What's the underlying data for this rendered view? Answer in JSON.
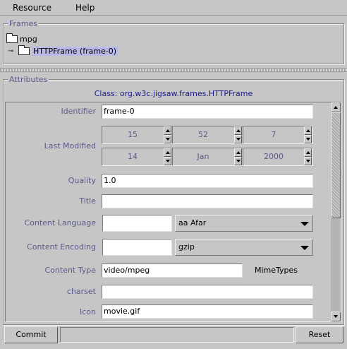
{
  "menubar": {
    "items": [
      "Resource",
      "Help"
    ]
  },
  "frames": {
    "title": "Frames",
    "items": [
      {
        "label": "mpg",
        "expanded": false,
        "selected": false
      },
      {
        "label": "HTTPFrame (frame-0)",
        "expander": "⊸",
        "selected": true
      }
    ]
  },
  "attributes": {
    "title": "Attributes",
    "class_label": "Class: org.w3c.jigsaw.frames.HTTPFrame",
    "identifier": {
      "label": "Identifier",
      "value": "frame-0"
    },
    "last_modified": {
      "label": "Last Modified",
      "row1": [
        "15",
        "52",
        "7"
      ],
      "row2": [
        "14",
        "Jan",
        "2000"
      ]
    },
    "quality": {
      "label": "Quality",
      "value": "1.0"
    },
    "title_field": {
      "label": "Title",
      "value": ""
    },
    "content_language": {
      "label": "Content Language",
      "value": "",
      "select": "aa  Afar"
    },
    "content_encoding": {
      "label": "Content Encoding",
      "value": "",
      "select": "gzip"
    },
    "content_type": {
      "label": "Content Type",
      "value": "video/mpeg",
      "extra": "MimeTypes"
    },
    "charset": {
      "label": "charset",
      "value": ""
    },
    "icon": {
      "label": "Icon",
      "value": "movie.gif"
    }
  },
  "buttons": {
    "commit": "Commit",
    "reset": "Reset"
  },
  "colors": {
    "background": "#c6c6c6",
    "label": "#5a5a8a",
    "class_label": "#1a1a8a",
    "selection": "#b9b9e8"
  }
}
